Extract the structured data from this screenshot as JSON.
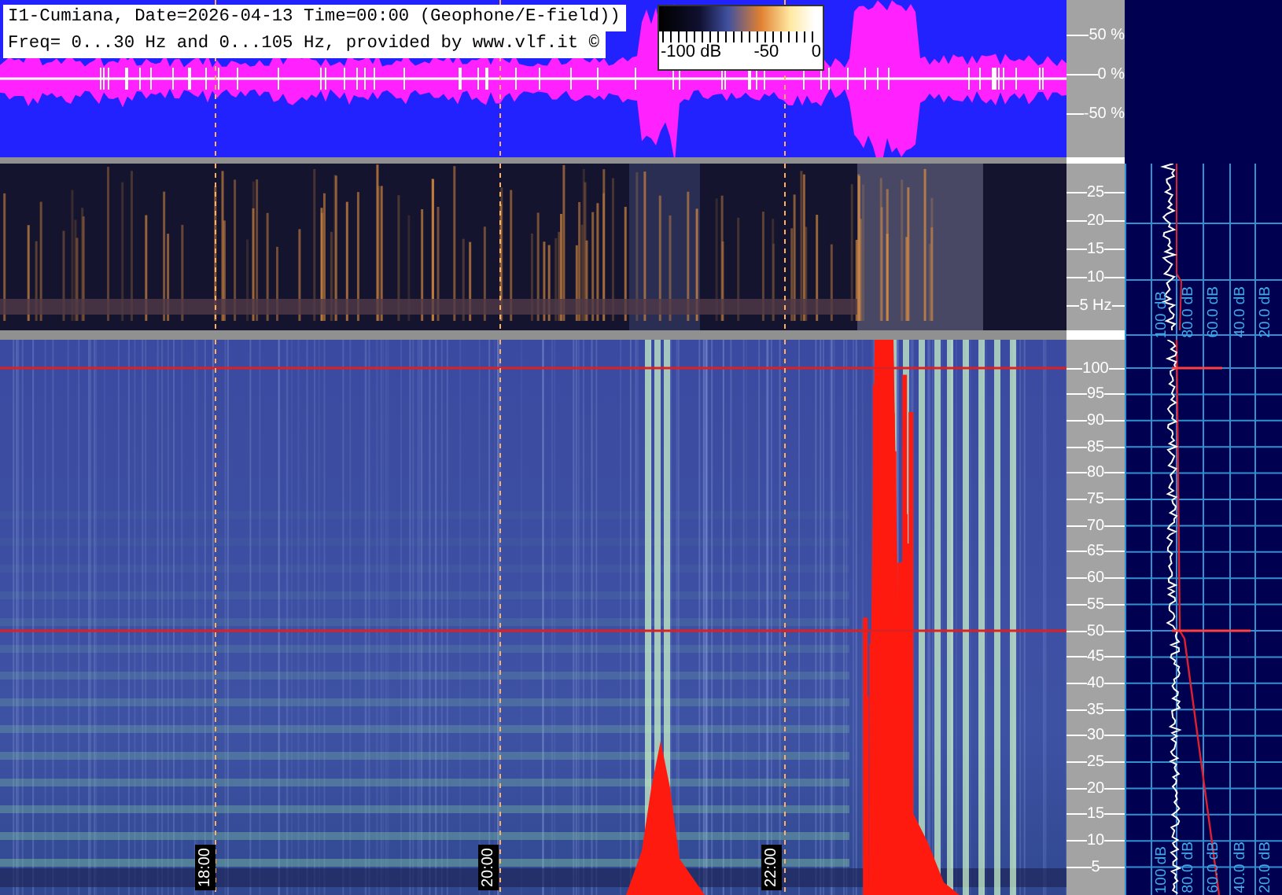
{
  "header": {
    "line1": "I1-Cumiana, Date=2026-04-13 Time=00:00 (Geophone/E-field))",
    "line2": "Freq= 0...30 Hz and 0...105 Hz, provided by www.vlf.it ©"
  },
  "colorbar": {
    "labels": [
      "-100 dB",
      "-50",
      "0"
    ]
  },
  "waveform_axis": [
    "50 %",
    "0 %",
    "-50 %"
  ],
  "low_band_axis": [
    "25",
    "20",
    "15",
    "10",
    "5 Hz"
  ],
  "high_band_axis": [
    "100",
    "95",
    "90",
    "85",
    "80",
    "75",
    "70",
    "65",
    "60",
    "55",
    "50",
    "45",
    "40",
    "35",
    "30",
    "25",
    "20",
    "15",
    "10",
    "5"
  ],
  "time_labels": [
    "18:00",
    "20:00",
    "22:00"
  ],
  "low_band_spectrum_labels": [
    "100 dB",
    "80.0 dB",
    "60.0 dB",
    "40.0 dB",
    "20.0 dB"
  ],
  "high_band_spectrum_labels": [
    "100 dB",
    "80.0 dB",
    "60.0 dB",
    "40.0 dB",
    "20.0 dB"
  ]
}
